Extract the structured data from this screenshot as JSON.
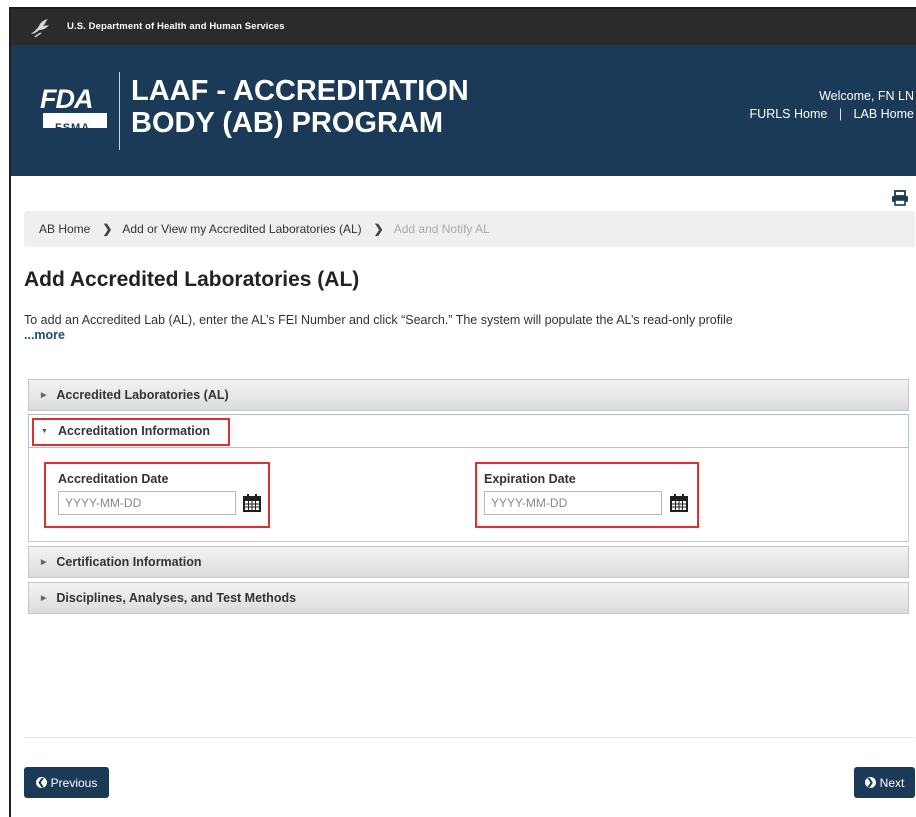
{
  "hhs_bar": {
    "text": "U.S. Department of Health and Human Services",
    "icon": "hhs-eagle-icon"
  },
  "header": {
    "logo_text": "FDA",
    "logo_subtext": "FSMA",
    "program_title": "LAAF - ACCREDITATION\nBODY (AB) PROGRAM",
    "welcome": "Welcome, FN LN",
    "links": {
      "furls_home": "FURLS Home",
      "separator": "|",
      "lab_home": "LAB Home"
    },
    "print_icon": "printer-icon"
  },
  "breadcrumb": {
    "items": [
      "AB Home",
      "Add or View my Accredited Laboratories (AL)"
    ],
    "current": "Add and Notify AL",
    "separator_icon": "chevron-right-icon"
  },
  "page": {
    "title": "Add Accredited Laboratories (AL)",
    "intro": "To add an Accredited Lab (AL), enter the AL’s FEI Number and click “Search.” The system will populate the AL’s read-only profile",
    "more": "...more"
  },
  "accordion": {
    "sections": [
      {
        "label": "Accredited Laboratories (AL)",
        "expanded": false
      },
      {
        "label": "Accreditation Information",
        "expanded": true
      },
      {
        "label": "Certification Information",
        "expanded": false
      },
      {
        "label": "Disciplines, Analyses, and Test Methods",
        "expanded": false
      }
    ],
    "fields": {
      "accreditation_date": {
        "label": "Accreditation Date",
        "placeholder": "YYYY-MM-DD",
        "value": ""
      },
      "expiration_date": {
        "label": "Expiration Date",
        "placeholder": "YYYY-MM-DD",
        "value": ""
      }
    }
  },
  "buttons": {
    "previous": "Previous",
    "next": "Next"
  },
  "colors": {
    "header_bg": "#1b3a57",
    "top_bar_bg": "#2b2b2b",
    "highlight": "#e0302e",
    "button_bg": "#1b3a57"
  }
}
